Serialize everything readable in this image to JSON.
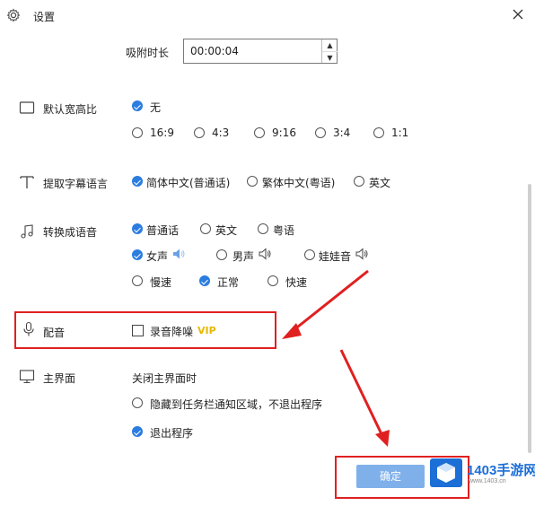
{
  "window": {
    "title": "设置"
  },
  "snap": {
    "label": "吸附时长",
    "value": "00:00:04"
  },
  "aspect": {
    "label": "默认宽高比",
    "none_label": "无",
    "options": [
      "16:9",
      "4:3",
      "9:16",
      "3:4",
      "1:1"
    ]
  },
  "subtitle": {
    "label": "提取字幕语言",
    "options": [
      "简体中文(普通话)",
      "繁体中文(粤语)",
      "英文"
    ]
  },
  "voice": {
    "label": "转换成语音",
    "languages": [
      "普通话",
      "英文",
      "粤语"
    ],
    "voices": [
      "女声",
      "男声",
      "娃娃音"
    ],
    "speeds": [
      "慢速",
      "正常",
      "快速"
    ]
  },
  "dubbing": {
    "label": "配音",
    "noise_label": "录音降噪",
    "vip": "VIP"
  },
  "main_ui": {
    "label": "主界面",
    "desc": "关闭主界面时",
    "options": [
      "隐藏到任务栏通知区域，不退出程序",
      "退出程序"
    ]
  },
  "confirm": {
    "label": "确定"
  },
  "watermark": {
    "brand": "1403手游网",
    "sub": "www.1403.cn"
  },
  "colors": {
    "accent": "#2b7de0",
    "highlight": "#e02020",
    "vip": "#e6b800"
  }
}
